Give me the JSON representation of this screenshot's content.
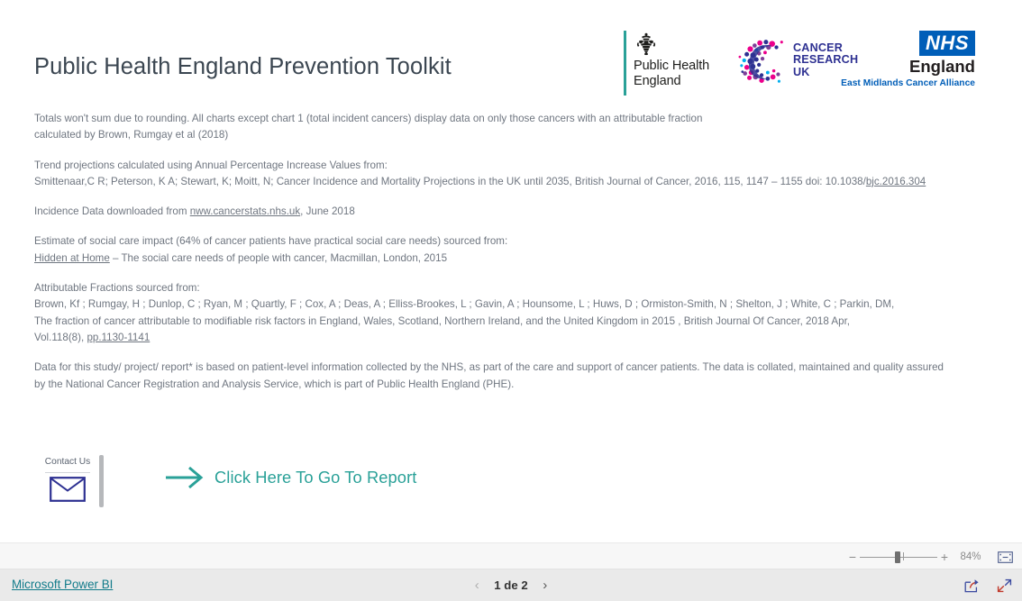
{
  "report": {
    "title": "Public Health England Prevention Toolkit"
  },
  "logos": {
    "phe": {
      "name": "phe-logo",
      "line1": "Public Health",
      "line2": "England",
      "crest_icon": "royal-crest-icon",
      "accent_color": "#2aa198"
    },
    "cruk": {
      "name": "cancer-research-uk-logo",
      "line1": "CANCER",
      "line2": "RESEARCH",
      "line3": "UK",
      "mark_icon": "dotted-c-icon",
      "text_color": "#2e3192",
      "dot_colors": [
        "#ec008c",
        "#2e3192",
        "#00aeef",
        "#7e3f98"
      ]
    },
    "nhs": {
      "name": "nhs-england-logo",
      "badge": "NHS",
      "region": "England",
      "alliance": "East Midlands Cancer Alliance",
      "badge_color": "#005eb8"
    }
  },
  "notes": [
    {
      "name": "note-rounding",
      "lines": [
        "Totals won't sum due to rounding. All charts except chart 1 (total incident cancers) display data on only those cancers with an attributable fraction",
        "calculated by Brown, Rumgay et al (2018)"
      ]
    },
    {
      "name": "note-trend-projections",
      "lines": [
        "Trend projections calculated using Annual Percentage Increase Values from:"
      ],
      "citation_prefix": "Smittenaar,C R; Peterson, K A; Stewart, K; Moitt, N; Cancer Incidence and Mortality Projections in the UK until 2035, British Journal of Cancer, 2016, 115, 1147 – 1155 doi: 10.1038/",
      "citation_link": "bjc.2016.304"
    },
    {
      "name": "note-incidence-data",
      "prefix": "Incidence Data downloaded from ",
      "link": "nww.cancerstats.nhs.uk",
      "suffix": ", June 2018"
    },
    {
      "name": "note-social-care",
      "lines": [
        "Estimate of social care impact (64% of cancer patients have practical social care needs) sourced from:"
      ],
      "link": "Hidden at Home",
      "suffix": " – The social care needs of people with cancer, Macmillan, London, 2015"
    },
    {
      "name": "note-attributable-fractions",
      "lines": [
        "Attributable Fractions sourced from:",
        "Brown, Kf ; Rumgay, H ; Dunlop, C ; Ryan, M ; Quartly, F ; Cox, A ; Deas, A ; Elliss-Brookes, L ; Gavin, A ; Hounsome, L ; Huws, D ; Ormiston-Smith, N ; Shelton, J ; White, C ; Parkin, DM,",
        "The fraction of cancer attributable to modifiable risk factors in England, Wales, Scotland, Northern Ireland, and the United Kingdom in 2015 , British Journal Of Cancer, 2018 Apr,"
      ],
      "last_line_prefix": "Vol.118(8), ",
      "last_line_link": "pp.1130-1141"
    },
    {
      "name": "note-data-provenance",
      "lines": [
        "Data for this study/ project/ report* is based on patient-level information collected by the NHS, as part of the care and support of cancer patients. The data is collated, maintained and quality assured",
        "by the National Cancer Registration and Analysis Service, which is part of Public Health England (PHE)."
      ]
    }
  ],
  "contact": {
    "label": "Contact Us",
    "envelope_icon": "envelope-icon",
    "envelope_color": "#2e3192"
  },
  "cta": {
    "label": "Click Here To Go To Report",
    "arrow_icon": "right-arrow-icon",
    "color": "#2aa198"
  },
  "zoom_toolbar": {
    "minus_label": "−",
    "plus_label": "+",
    "value": "84%",
    "fit_icon": "fit-to-page-icon"
  },
  "status_bar": {
    "brand_link": "Microsoft Power BI",
    "brand_color": "#117b8a",
    "pager": {
      "prev_icon": "chevron-left-icon",
      "next_icon": "chevron-right-icon",
      "label": "1 de 2"
    },
    "actions": [
      {
        "name": "share-icon"
      },
      {
        "name": "fullscreen-icon"
      }
    ]
  }
}
